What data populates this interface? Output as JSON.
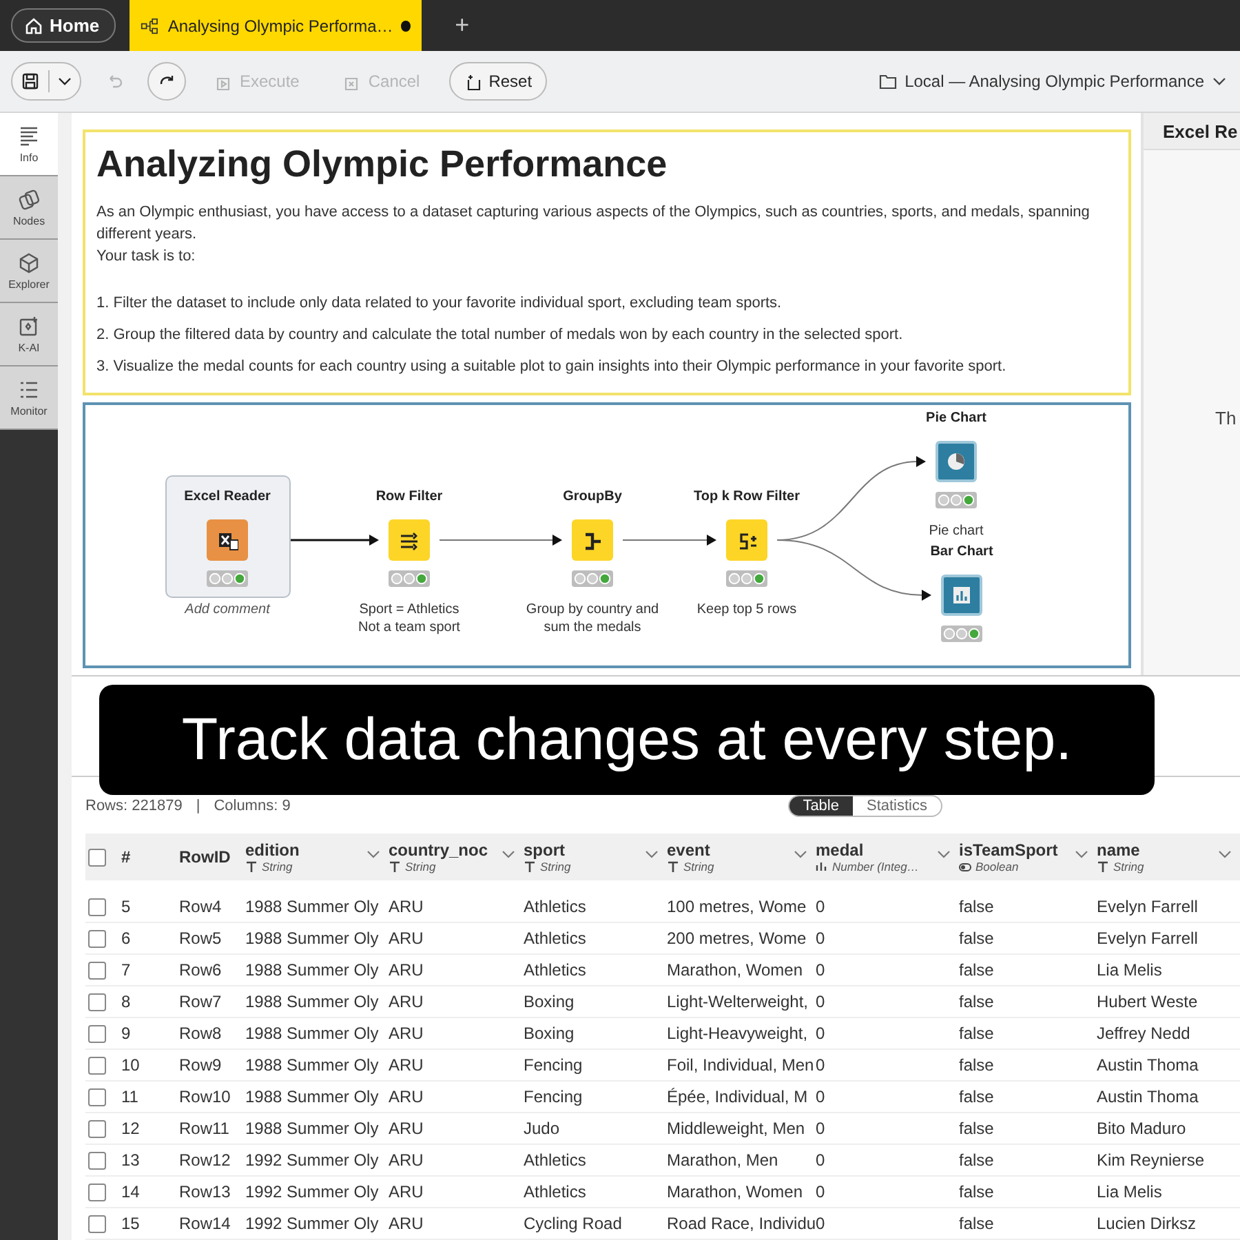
{
  "tabs": [
    {
      "kind": "home",
      "label": "Home",
      "selected": false
    },
    {
      "kind": "workflow",
      "label": "Analysing Olympic Performa…",
      "selected": true,
      "unsaved": true
    }
  ],
  "new_tab": "+",
  "toolbar": {
    "buttons": [
      {
        "kind": "save",
        "disabled": false
      },
      {
        "kind": "undo",
        "disabled": true
      },
      {
        "kind": "redo",
        "disabled": false
      },
      {
        "kind": "execute",
        "label": "Execute",
        "disabled": true
      },
      {
        "kind": "cancel",
        "label": "Cancel",
        "disabled": true
      },
      {
        "kind": "reset",
        "label": "Reset",
        "disabled": false
      }
    ],
    "breadcrumb": "Local — Analysing Olympic Performance"
  },
  "sidebar": {
    "items": [
      {
        "label": "Info",
        "selected": true
      },
      {
        "label": "Nodes",
        "selected": false
      },
      {
        "label": "Explorer",
        "selected": false
      },
      {
        "label": "K-AI",
        "selected": false
      },
      {
        "label": "Monitor",
        "selected": false
      }
    ]
  },
  "annotation": {
    "title": "Analyzing Olympic Performance",
    "paragraphs": [
      {
        "kind": "intro",
        "text": "As an Olympic enthusiast, you have access to a dataset capturing various aspects of the Olympics, such as countries, sports, and medals, spanning different years."
      },
      {
        "kind": "intro",
        "text": "Your task is to:"
      },
      {
        "kind": "step",
        "text": "1. Filter the dataset to include only data related to your favorite individual sport, excluding team sports."
      },
      {
        "kind": "step",
        "text": "2. Group the filtered data by country and calculate the total number of medals won by each country in the selected sport."
      },
      {
        "kind": "step",
        "text": "3. Visualize the medal counts for each country using a suitable plot to gain insights into their Olympic performance in your favorite sport."
      }
    ]
  },
  "workflow": {
    "nodes": [
      {
        "name": "Excel Reader",
        "kind": "source",
        "selected": true,
        "comment": "Add comment"
      },
      {
        "name": "Row Filter",
        "kind": "manipulator",
        "selected": false,
        "comment": "Sport = Athletics\nNot a team sport"
      },
      {
        "name": "GroupBy",
        "kind": "manipulator",
        "selected": false,
        "comment": "Group by country and\nsum the medals"
      },
      {
        "name": "Top k Row Filter",
        "kind": "manipulator",
        "selected": false,
        "comment": "Keep top 5 rows"
      },
      {
        "name": "Pie Chart",
        "kind": "view",
        "selected": false,
        "comment": "Pie chart"
      },
      {
        "name": "Bar Chart",
        "kind": "view",
        "selected": false
      }
    ]
  },
  "right_panel": {
    "title": "Excel Re",
    "text": "Th"
  },
  "caption": "Track data changes at every step.",
  "table_panel": {
    "rows_count": "Rows: 221879",
    "separator": "|",
    "columns_count": "Columns: 9",
    "view_tabs": [
      {
        "label": "Table",
        "selected": true
      },
      {
        "label": "Statistics",
        "selected": false
      }
    ],
    "all_checked": false,
    "columns": [
      {
        "name": "#"
      },
      {
        "name": "RowID"
      },
      {
        "name": "edition",
        "type": "String"
      },
      {
        "name": "country_noc",
        "type": "String"
      },
      {
        "name": "sport",
        "type": "String"
      },
      {
        "name": "event",
        "type": "String"
      },
      {
        "name": "medal",
        "type": "Number (Integ…"
      },
      {
        "name": "isTeamSport",
        "type": "Boolean"
      },
      {
        "name": "name",
        "type": "String"
      }
    ],
    "rows": [
      {
        "checked": false,
        "cells": [
          "5",
          "Row4",
          "1988 Summer Oly",
          "ARU",
          "Athletics",
          "100 metres, Wome",
          "0",
          "false",
          "Evelyn Farrell"
        ]
      },
      {
        "checked": false,
        "cells": [
          "6",
          "Row5",
          "1988 Summer Oly",
          "ARU",
          "Athletics",
          "200 metres, Wome",
          "0",
          "false",
          "Evelyn Farrell"
        ]
      },
      {
        "checked": false,
        "cells": [
          "7",
          "Row6",
          "1988 Summer Oly",
          "ARU",
          "Athletics",
          "Marathon, Women",
          "0",
          "false",
          "Lia Melis"
        ]
      },
      {
        "checked": false,
        "cells": [
          "8",
          "Row7",
          "1988 Summer Oly",
          "ARU",
          "Boxing",
          "Light-Welterweight,",
          "0",
          "false",
          "Hubert Weste"
        ]
      },
      {
        "checked": false,
        "cells": [
          "9",
          "Row8",
          "1988 Summer Oly",
          "ARU",
          "Boxing",
          "Light-Heavyweight,",
          "0",
          "false",
          "Jeffrey Nedd"
        ]
      },
      {
        "checked": false,
        "cells": [
          "10",
          "Row9",
          "1988 Summer Oly",
          "ARU",
          "Fencing",
          "Foil, Individual, Men",
          "0",
          "false",
          "Austin Thoma"
        ]
      },
      {
        "checked": false,
        "cells": [
          "11",
          "Row10",
          "1988 Summer Oly",
          "ARU",
          "Fencing",
          "Épée, Individual, M",
          "0",
          "false",
          "Austin Thoma"
        ]
      },
      {
        "checked": false,
        "cells": [
          "12",
          "Row11",
          "1988 Summer Oly",
          "ARU",
          "Judo",
          "Middleweight, Men",
          "0",
          "false",
          "Bito Maduro"
        ]
      },
      {
        "checked": false,
        "cells": [
          "13",
          "Row12",
          "1992 Summer Oly",
          "ARU",
          "Athletics",
          "Marathon, Men",
          "0",
          "false",
          "Kim Reynierse"
        ]
      },
      {
        "checked": false,
        "cells": [
          "14",
          "Row13",
          "1992 Summer Oly",
          "ARU",
          "Athletics",
          "Marathon, Women",
          "0",
          "false",
          "Lia Melis"
        ]
      },
      {
        "checked": false,
        "cells": [
          "15",
          "Row14",
          "1992 Summer Oly",
          "ARU",
          "Cycling Road",
          "Road Race, Individu",
          "0",
          "false",
          "Lucien Dirksz"
        ]
      }
    ]
  }
}
